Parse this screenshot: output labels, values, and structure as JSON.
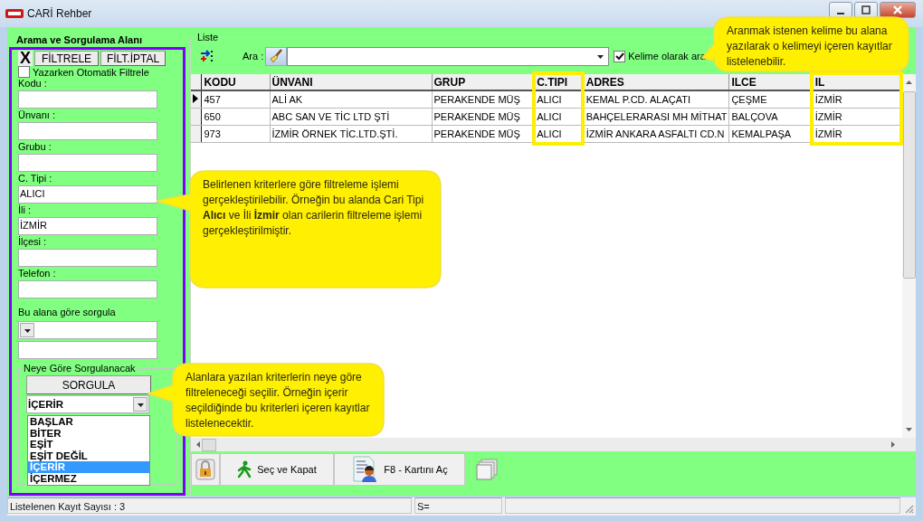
{
  "window": {
    "title": "CARİ Rehber"
  },
  "filter_panel": {
    "title": "Arama ve Sorgulama Alanı",
    "clear_button": "X",
    "filter_button": "FİLTRELE",
    "cancel_button": "FİLT.İPTAL",
    "auto_filter": {
      "label": "Yazarken Otomatik Filtrele",
      "checked": false
    },
    "fields": [
      {
        "label": "Kodu :"
      },
      {
        "label": "Ünvanı :"
      },
      {
        "label": "Grubu :"
      },
      {
        "label": "C. Tipi :",
        "value": "ALICI"
      },
      {
        "label": "İli :",
        "value": "İZMİR"
      },
      {
        "label": "İlçesi :"
      },
      {
        "label": "Telefon :"
      }
    ],
    "query_field": {
      "label": "Bu alana göre sorgula"
    },
    "match_group": {
      "title": "Neye Göre Sorgulanacak",
      "query_button": "SORGULA",
      "value": "İÇERİR",
      "options": [
        {
          "label": "BAŞLAR",
          "selected": false
        },
        {
          "label": "BİTER",
          "selected": false
        },
        {
          "label": "EŞİT",
          "selected": false
        },
        {
          "label": "EŞİT DEĞİL",
          "selected": false
        },
        {
          "label": "İÇERİR",
          "selected": true
        },
        {
          "label": "İÇERMEZ",
          "selected": false
        }
      ]
    }
  },
  "list": {
    "title": "Liste",
    "search_label": "Ara :",
    "word_search": {
      "label": "Kelime olarak ara",
      "checked": true
    },
    "table": {
      "columns": [
        {
          "label": "KODU",
          "highlighted": false
        },
        {
          "label": "ÜNVANI",
          "highlighted": false
        },
        {
          "label": "GRUP",
          "highlighted": false
        },
        {
          "label": "C.TIPI",
          "highlighted": true
        },
        {
          "label": "ADRES",
          "highlighted": false
        },
        {
          "label": "ILCE",
          "highlighted": false
        },
        {
          "label": "IL",
          "highlighted": true
        }
      ],
      "rows": [
        {
          "selected": true,
          "cells": [
            "457",
            "ALİ AK",
            "PERAKENDE MÜŞ",
            "ALICI",
            "KEMAL P.CD.  ALAÇATI",
            "ÇEŞME",
            "İZMİR"
          ]
        },
        {
          "selected": false,
          "cells": [
            "650",
            "ABC SAN VE TİC LTD ŞTİ",
            "PERAKENDE MÜŞ",
            "ALICI",
            "BAHÇELERARASI MH MİTHAT",
            "BALÇOVA",
            "İZMİR"
          ]
        },
        {
          "selected": false,
          "cells": [
            "973",
            "İZMİR ÖRNEK TİC.LTD.ŞTİ.",
            "PERAKENDE MÜŞ",
            "ALICI",
            "İZMİR ANKARA ASFALTI CD.N",
            "KEMALPAŞA",
            "İZMİR"
          ]
        }
      ]
    }
  },
  "toolbar": {
    "buttons": [
      {
        "label": "Seç ve Kapat",
        "kind": "walk"
      },
      {
        "label": "F8 - Kartını Aç",
        "kind": "card"
      }
    ]
  },
  "status_bar": [
    "Listelenen Kayıt Sayısı : 3",
    "S="
  ],
  "callouts": [
    {
      "text": "Aranmak istenen kelime bu alana yazılarak o kelimeyi içeren kayıtlar listelenebilir."
    },
    {
      "text": "Belirlenen kriterlere göre filtreleme işlemi gerçekleştirilebilir. Örneğin bu alanda Cari Tipi **Alıcı** ve İli **İzmir** olan carilerin filtreleme işlemi gerçekleştirilmiştir."
    },
    {
      "text": "Alanlara yazılan kriterlerin neye göre filtreleneceği seçilir. Örneğin içerir seçildiğinde bu kriterleri içeren kayıtlar listelenecektir."
    }
  ]
}
